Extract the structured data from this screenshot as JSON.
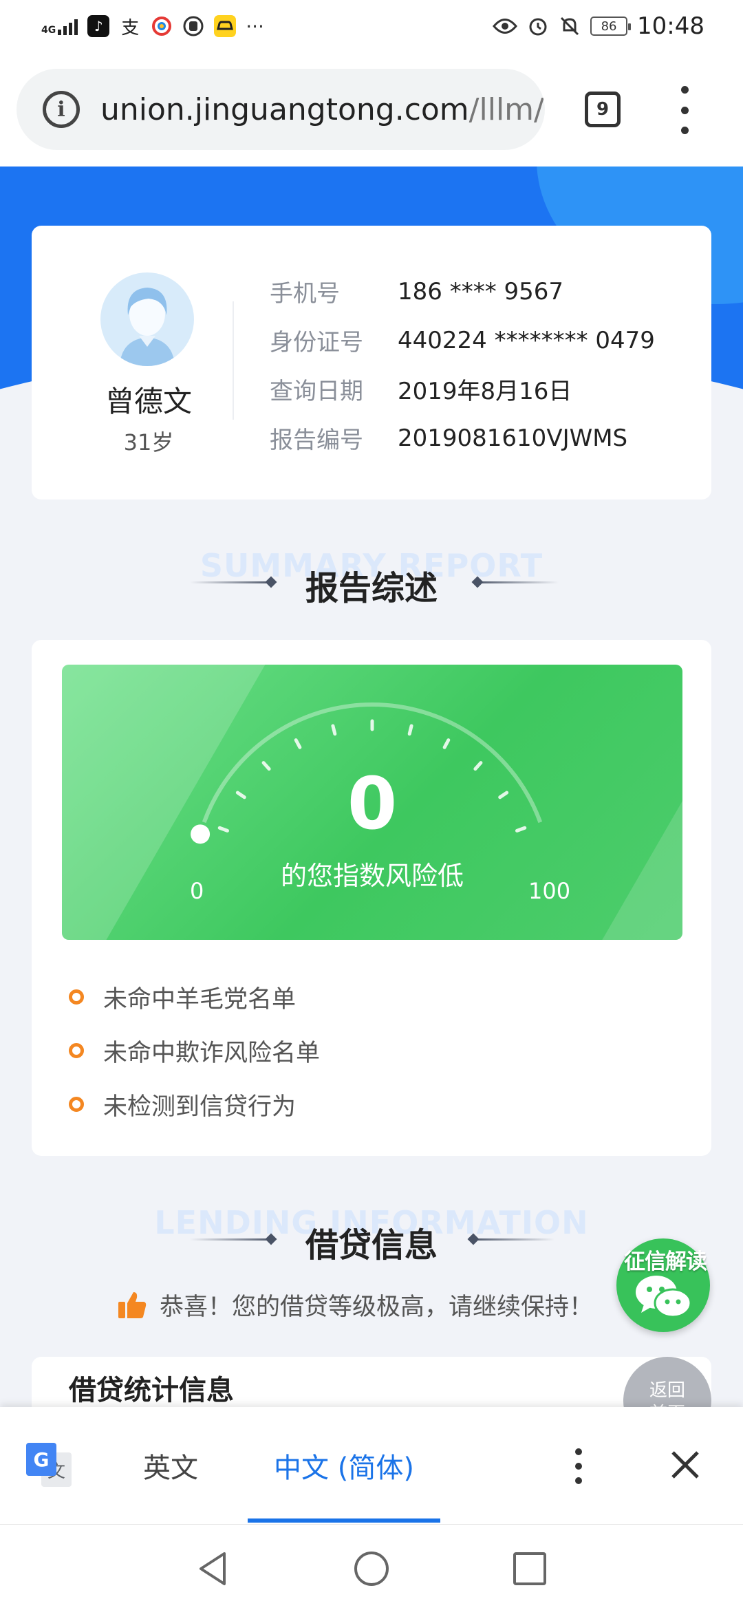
{
  "status_bar": {
    "network": "4G",
    "time": "10:48",
    "battery": "86",
    "app_icons": [
      "tiktok-icon",
      "alipay-icon",
      "weibo-icon",
      "hand-icon",
      "car-icon"
    ],
    "more": "···"
  },
  "browser": {
    "url_host": "union.jinguangtong.com",
    "url_path": "/lllm/",
    "tab_count": "9"
  },
  "profile": {
    "name": "曾德文",
    "age": "31岁",
    "fields": [
      {
        "label": "手机号",
        "value": "186 **** 9567"
      },
      {
        "label": "身份证号",
        "value": "440224 ******** 0479"
      },
      {
        "label": "查询日期",
        "value": "2019年8月16日"
      },
      {
        "label": "报告编号",
        "value": "2019081610VJWMS"
      }
    ]
  },
  "summary": {
    "ghost": "SUMMARY REPORT",
    "title": "报告综述",
    "score": "0",
    "score_text": "的您指数风险低",
    "gauge_min": "0",
    "gauge_max": "100",
    "score_fraction": 0,
    "bullets": [
      "未命中羊毛党名单",
      "未命中欺诈风险名单",
      "未检测到信贷行为"
    ]
  },
  "lending": {
    "ghost": "LENDING INFORMATION",
    "title": "借贷信息",
    "note": "恭喜！您的借贷等级极高，请继续保持！",
    "card_heading": "借贷统计信息"
  },
  "floats": {
    "wechat_label": "征信解读",
    "back_line1": "返回",
    "back_line2": "首页"
  },
  "translate_bar": {
    "lang_from": "英文",
    "lang_to": "中文 (简体)"
  },
  "colors": {
    "primary_blue": "#1c74f2",
    "gauge_green": "#3ec85f",
    "bullet_orange": "#f48721",
    "translate_blue": "#1a73e8"
  }
}
